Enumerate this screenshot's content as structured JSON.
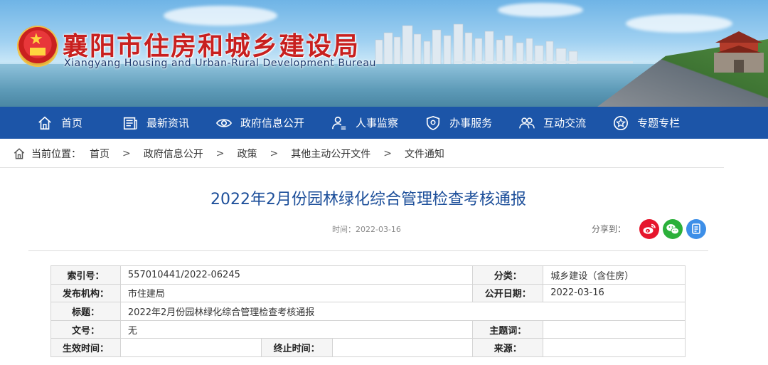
{
  "site": {
    "title": "襄阳市住房和城乡建设局",
    "subtitle": "Xiangyang Housing and Urban-Rural Development Bureau"
  },
  "nav": [
    {
      "label": "首页",
      "icon": "home-icon"
    },
    {
      "label": "最新资讯",
      "icon": "news-icon"
    },
    {
      "label": "政府信息公开",
      "icon": "eye-icon"
    },
    {
      "label": "人事监察",
      "icon": "person-icon"
    },
    {
      "label": "办事服务",
      "icon": "shield-icon"
    },
    {
      "label": "互动交流",
      "icon": "people-icon"
    },
    {
      "label": "专题专栏",
      "icon": "star-icon"
    }
  ],
  "breadcrumb": {
    "label": "当前位置：",
    "items": [
      "首页",
      "政府信息公开",
      "政策",
      "其他主动公开文件",
      "文件通知"
    ],
    "separator": ">"
  },
  "article": {
    "title": "2022年2月份园林绿化综合管理检查考核通报",
    "time": "时间：2022-03-16",
    "share_label": "分享到："
  },
  "share": {
    "weibo_color": "#e6162d",
    "wechat_color": "#2bb03a",
    "other_color": "#3d8fe8"
  },
  "info": {
    "index_label": "索引号：",
    "index_value": "557010441/2022-06245",
    "category_label": "分类：",
    "category_value": "城乡建设（含住房）",
    "publisher_label": "发布机构：",
    "publisher_value": "市住建局",
    "pubdate_label": "公开日期：",
    "pubdate_value": "2022-03-16",
    "title_label": "标题：",
    "title_value": "2022年2月份园林绿化综合管理检查考核通报",
    "docno_label": "文号：",
    "docno_value": "无",
    "keywords_label": "主题词：",
    "keywords_value": "",
    "effective_label": "生效时间：",
    "effective_value": "",
    "end_label": "终止时间：",
    "end_value": "",
    "source_label": "来源：",
    "source_value": ""
  },
  "colors": {
    "nav_bg": "#1c55a8",
    "title_red": "#c8201f",
    "article_title": "#1d4f9a"
  }
}
